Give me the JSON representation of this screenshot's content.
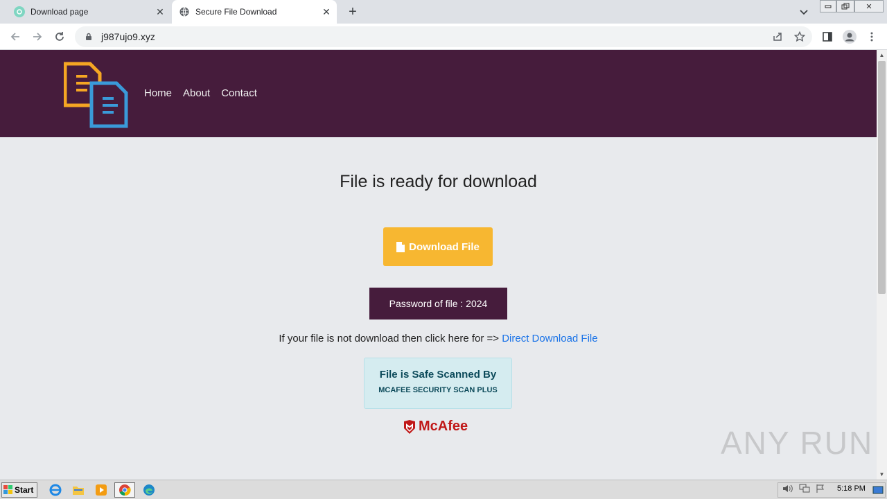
{
  "browser": {
    "tabs": [
      {
        "title": "Download page",
        "active": false
      },
      {
        "title": "Secure File Download",
        "active": true
      }
    ],
    "url": "j987ujo9.xyz"
  },
  "site": {
    "nav": [
      "Home",
      "About",
      "Contact"
    ],
    "heading": "File is ready for download",
    "download_button": "Download File",
    "password_text": "Password of file : 2024",
    "direct_prefix": "If your file is not download then click here for => ",
    "direct_link": "Direct Download File",
    "safe_line1": "File is Safe Scanned By",
    "safe_line2": "MCAFEE SECURITY SCAN PLUS",
    "mcafee_logo": "McAfee",
    "colors": {
      "header": "#461c3c",
      "button": "#f7b731",
      "link": "#1a73e8"
    }
  },
  "watermark": "ANY RUN",
  "taskbar": {
    "start_label": "Start",
    "clock": "5:18 PM"
  }
}
